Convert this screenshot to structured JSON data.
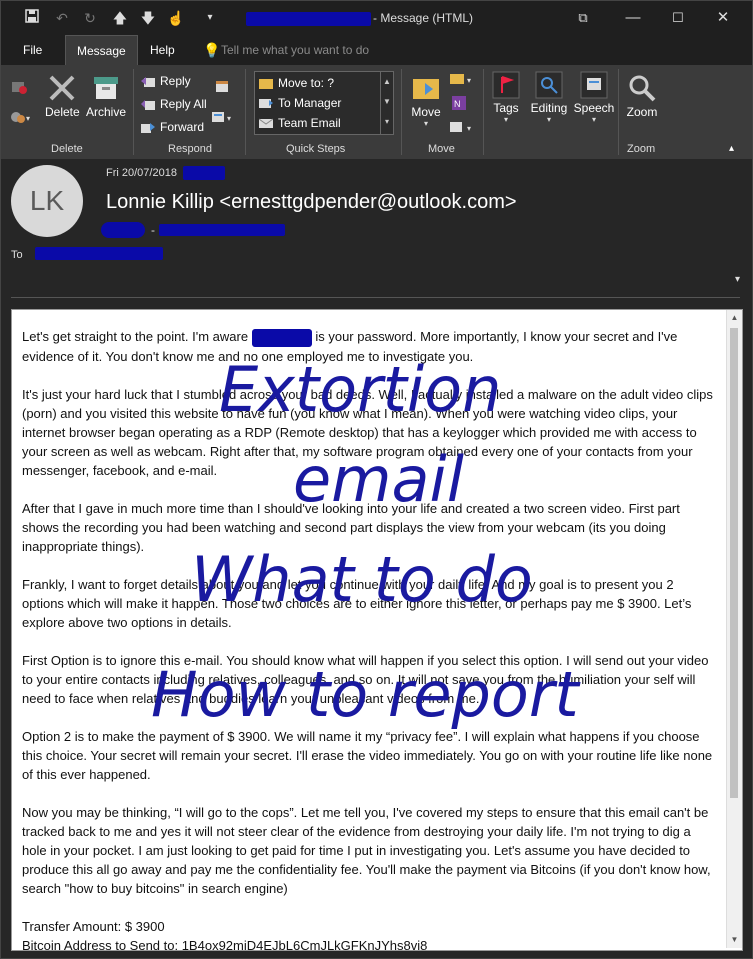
{
  "window": {
    "title": "- Message (HTML)"
  },
  "tabs": [
    {
      "label": "File"
    },
    {
      "label": "Message"
    },
    {
      "label": "Help"
    }
  ],
  "tell_me": {
    "placeholder": "Tell me what you want to do"
  },
  "ribbon": {
    "delete_group": {
      "label": "Delete",
      "delete": "Delete",
      "archive": "Archive"
    },
    "respond_group": {
      "label": "Respond",
      "reply": "Reply",
      "reply_all": "Reply All",
      "forward": "Forward"
    },
    "quick_steps": {
      "label": "Quick Steps",
      "items": [
        "Move to: ?",
        "To Manager",
        "Team Email"
      ]
    },
    "move_group": {
      "label": "Move",
      "move": "Move"
    },
    "tags": "Tags",
    "editing": "Editing",
    "speech": "Speech",
    "zoom_group": {
      "label": "Zoom",
      "zoom": "Zoom"
    }
  },
  "header": {
    "date": "Fri 20/07/2018",
    "sender": "Lonnie Killip <ernesttgdpender@outlook.com>",
    "avatar_initials": "LK",
    "to_label": "To"
  },
  "body": {
    "p1a": "Let's get straight to the point. I'm aware",
    "p1b": "is your password. More importantly, I know your secret and I've evidence of it. You don't know me and no one employed me to investigate you.",
    "p2": "It's just your hard luck that I stumbled across your bad deeds. Well, I actually installed a malware on the adult video clips (porn) and you visited this website to have fun (you know what I mean). When you were watching video clips, your internet browser began operating as a RDP (Remote desktop) that has a keylogger which provided me with access to your screen as well as webcam. Right after that, my software program obtained every one of your contacts from your messenger, facebook, and e-mail.",
    "p3": "After that I gave in much more time than I should've looking into your life and created a two screen video. First part shows the recording you had been watching and second part displays the view from your webcam (its you doing inappropriate things).",
    "p4": "Frankly, I want to forget details about you and let you continue with your daily life. And my goal is to present you 2 options which will make it happen. Those two choices are to either ignore this letter, or perhaps pay me $ 3900. Let’s explore above two options in details.",
    "p5": "First Option is to ignore this e-mail. You should know what will happen if you select this option. I will send out your video to your entire contacts including relatives, colleagues, and so on. It will not save you from the humiliation your self will need to face when relatives and buddies learn your unpleasant videos from me.",
    "p6": "Option 2 is to make the payment of $ 3900. We will name it my “privacy fee”. I will explain what happens if you choose this choice. Your secret will remain your secret. I'll erase the video immediately. You go on with your routine life like none of this ever happened.",
    "p7": "Now you may be thinking, “I will go to the cops”. Let me tell you, I've covered my steps to ensure that this email can't be tracked back to me and yes it will not steer clear of the evidence from destroying your daily life. I'm not trying to dig a hole in your pocket. I am just looking to get paid for time I put in investigating you. Let's assume you have decided to produce this all go away and pay me the confidentiality fee. You'll make the payment via Bitcoins (if you don't know how, search \"how to buy bitcoins\" in search engine)",
    "transfer": "Transfer Amount: $ 3900",
    "bitcoin": "Bitcoin Address to Send to: 1B4ox92miD4EJbL6CmJLkGFKnJYhs8vi8"
  },
  "overlay": {
    "line1": "Extortion",
    "line2": "email",
    "line3": "What to do",
    "line4": "How to report",
    "color": "#1a1aa0"
  }
}
